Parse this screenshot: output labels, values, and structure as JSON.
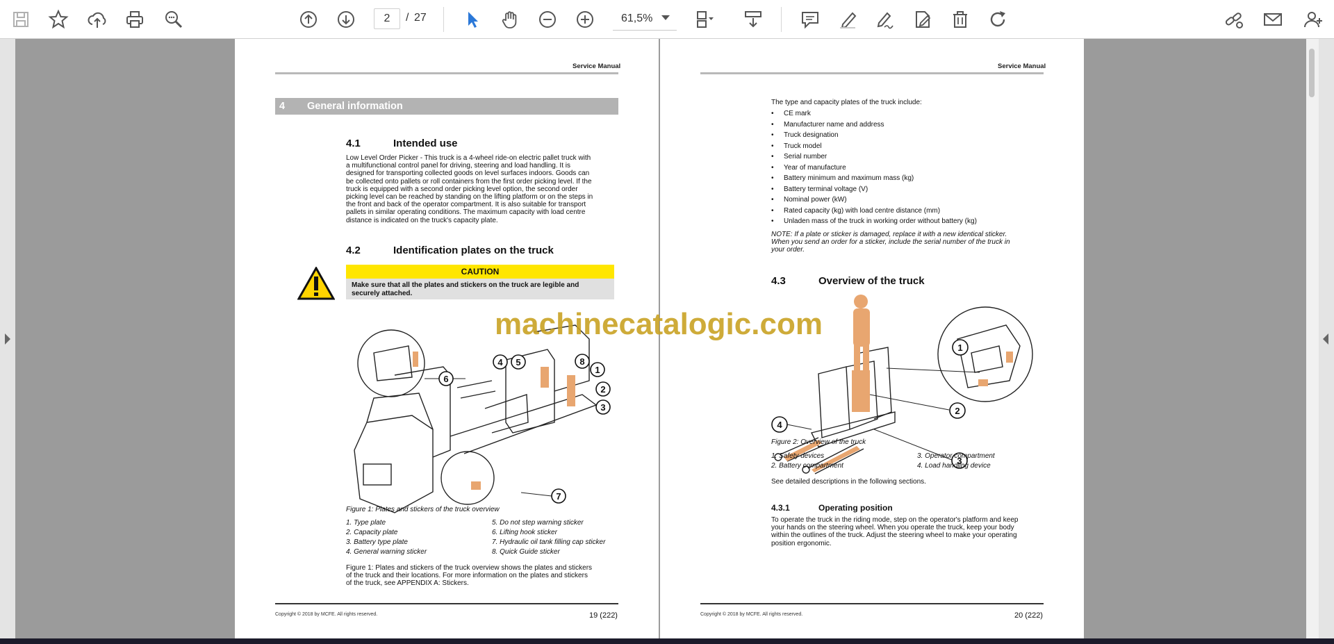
{
  "toolbar": {
    "current_page": "2",
    "page_separator": "/",
    "total_pages": "27",
    "zoom": "61,5%"
  },
  "watermark": "machinecatalogic.com",
  "page_left": {
    "running_head": "Service Manual",
    "chapter_number": "4",
    "chapter_title": "General information",
    "section_41_number": "4.1",
    "section_41_title": "Intended use",
    "section_41_lines": [
      "Low Level Order Picker - This truck is a 4-wheel ride-on electric pallet truck with",
      "a multifunctional control panel for driving, steering and load handling. It is",
      "designed for transporting collected goods on level surfaces indoors. Goods can",
      "be collected onto pallets or roll containers from the first order picking level. If the",
      "truck is equipped with a second order picking level option, the second order",
      "picking level can be reached by standing on the lifting platform or on the steps in",
      "the front and back of the operator compartment. It is also suitable for transport",
      "pallets in similar operating conditions. The maximum capacity with load centre",
      "distance is indicated on the truck's capacity plate."
    ],
    "section_42_number": "4.2",
    "section_42_title": "Identification plates on the truck",
    "caution_title": "CAUTION",
    "caution_lines": [
      "Make sure that all the plates and stickers on the truck are legible and",
      "securely attached."
    ],
    "figure_caption": "Figure 1: Plates and stickers of the truck overview",
    "legend_left": [
      "1.  Type plate",
      "2.  Capacity plate",
      "3.  Battery type plate",
      "4.  General warning sticker"
    ],
    "legend_right": [
      "5.  Do not step warning sticker",
      "6.  Lifting hook sticker",
      "7.  Hydraulic oil tank filling cap sticker",
      "8.  Quick Guide sticker"
    ],
    "closing_lines": [
      "Figure 1: Plates and stickers of the truck overview shows the plates and stickers",
      "of the truck and their locations. For more information on the plates and stickers",
      "of the truck, see APPENDIX A: Stickers."
    ],
    "callouts": [
      "1",
      "2",
      "3",
      "4",
      "5",
      "6",
      "7",
      "8"
    ],
    "copyright": "Copyright © 2018 by MCFE. All rights reserved.",
    "page_number": "19 (222)"
  },
  "page_right": {
    "running_head": "Service Manual",
    "intro": "The type and capacity plates of the truck include:",
    "bullets": [
      "CE mark",
      "Manufacturer name and address",
      "Truck designation",
      "Truck model",
      "Serial number",
      "Year of manufacture",
      "Battery minimum and maximum mass (kg)",
      "Battery terminal voltage (V)",
      "Nominal power (kW)",
      "Rated capacity (kg) with load centre distance (mm)",
      "Unladen mass of the truck in working order without battery (kg)"
    ],
    "note_lines": [
      "NOTE: If a plate or sticker is damaged, replace it with a new identical sticker.",
      "When you send an order for a sticker, include the serial number of the truck in",
      "your order."
    ],
    "section_43_number": "4.3",
    "section_43_title": "Overview of the truck",
    "figure_caption": "Figure 2: Overview of the truck",
    "legend_left": [
      "1.  Safety devices",
      "2.  Battery compartment"
    ],
    "legend_right": [
      "3.  Operator compartment",
      "4.  Load handling device"
    ],
    "see_more": "See detailed descriptions in the following sections.",
    "sub_431_number": "4.3.1",
    "sub_431_title": "Operating position",
    "sub_431_lines": [
      "To operate the truck in the riding mode, step on the operator's platform and keep",
      "your hands on the steering wheel. When you operate the truck, keep your body",
      "within the outlines of the truck. Adjust the steering wheel to make your operating",
      "position ergonomic."
    ],
    "callouts": [
      "1",
      "2",
      "3",
      "4"
    ],
    "copyright": "Copyright © 2018 by MCFE. All rights reserved.",
    "page_number": "20 (222)"
  }
}
